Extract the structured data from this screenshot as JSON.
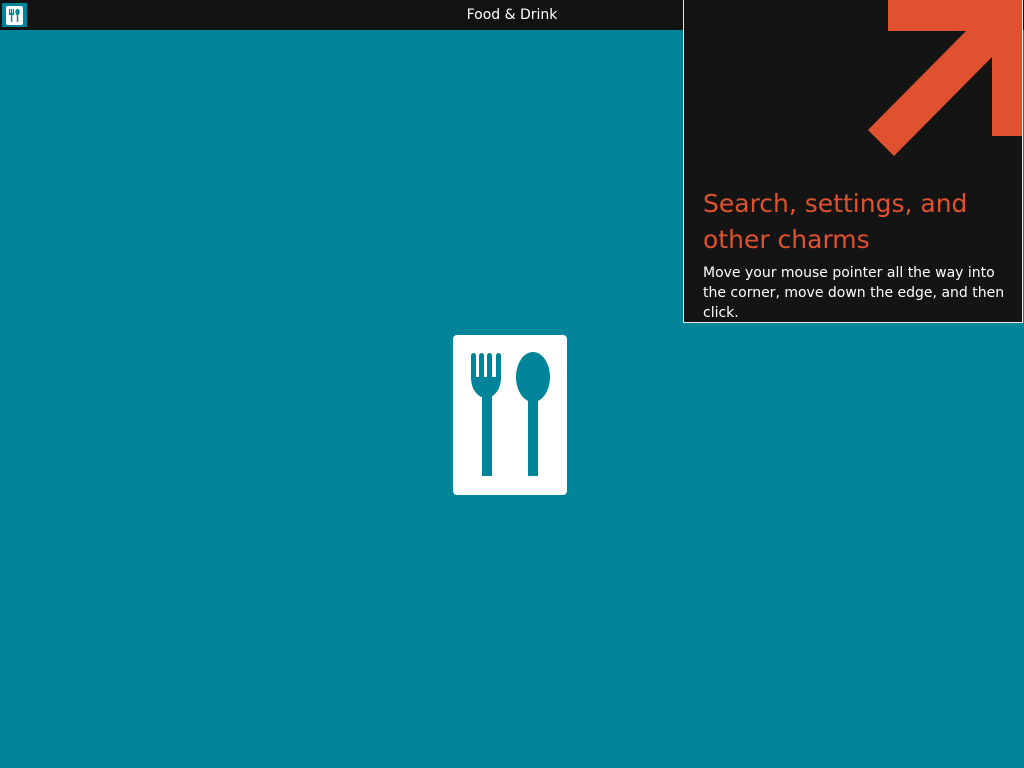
{
  "window": {
    "title": "Food & Drink",
    "app_icon": "fork-spoon-icon"
  },
  "splash": {
    "icon": "fork-spoon-icon",
    "background_color": "#00849a",
    "tile_color": "#ffffff"
  },
  "tip": {
    "heading": "Search, settings, and other charms",
    "body": "Move your mouse pointer all the way into the corner, move down the edge, and then click.",
    "arrow_icon": "diagonal-arrow-icon",
    "accent_color": "#e0522f",
    "background_color": "#141414"
  }
}
